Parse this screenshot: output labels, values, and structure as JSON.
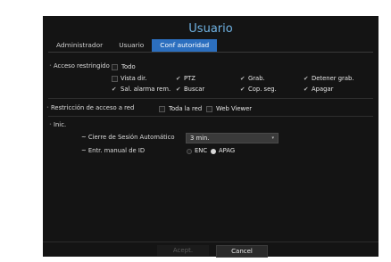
{
  "dialog": {
    "title": "Usuario",
    "tabs": [
      "Administrador",
      "Usuario",
      "Conf autoridad"
    ],
    "active_tab": "Conf autoridad"
  },
  "restricted_access": {
    "label": "Acceso restringido",
    "all": "Todo",
    "items": [
      {
        "label": "Vista dir.",
        "checked": false
      },
      {
        "label": "PTZ",
        "checked": true
      },
      {
        "label": "Grab.",
        "checked": true
      },
      {
        "label": "Detener grab.",
        "checked": true
      },
      {
        "label": "Sal. alarma rem.",
        "checked": true
      },
      {
        "label": "Buscar",
        "checked": true
      },
      {
        "label": "Cop. seg.",
        "checked": true
      },
      {
        "label": "Apagar",
        "checked": true
      }
    ]
  },
  "network": {
    "label": "Restricción de acceso a red",
    "opt1": "Toda la red",
    "opt2": "Web Viewer"
  },
  "init": {
    "label": "Inic.",
    "logout_label": "~ Cierre de Sesión Automático",
    "logout_value": "3 min.",
    "manual_id_label": "~ Entr. manual de ID",
    "enc": "ENC",
    "apag": "APAG",
    "selected": "APAG"
  },
  "buttons": {
    "accept": "Acept.",
    "cancel": "Cancel"
  }
}
